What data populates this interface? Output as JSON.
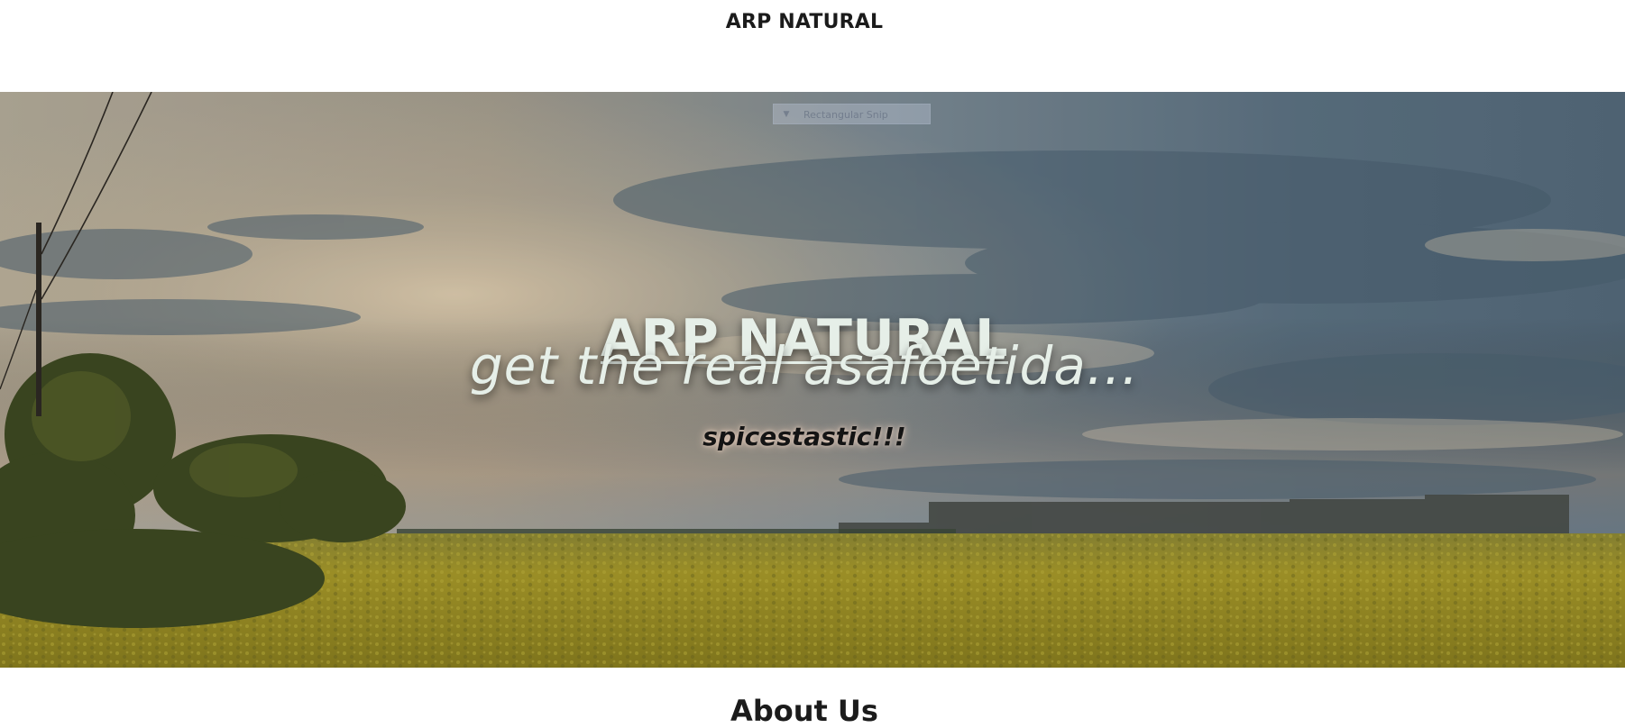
{
  "header": {
    "brand": "ARP NATURAL"
  },
  "hero": {
    "title": "ARP NATURAL",
    "tagline": "get the real asafoetida...",
    "subtagline": "spicestastic!!!",
    "background_image": "landscape-photo: cloudy sunset sky over yellow rapeseed field, trees at left, utility pole, factory buildings on horizon"
  },
  "overlay": {
    "snip_label": "Rectangular Snip",
    "snip_icon": "dropdown-arrow-icon"
  },
  "sections": {
    "about_heading": "About Us"
  },
  "colors": {
    "page_bg": "#ffffff",
    "text_dark": "#1b1b1b",
    "hero_text": "#e6efe8",
    "field_yellow": "#a89a2b",
    "sky_blue": "#5c7488"
  }
}
